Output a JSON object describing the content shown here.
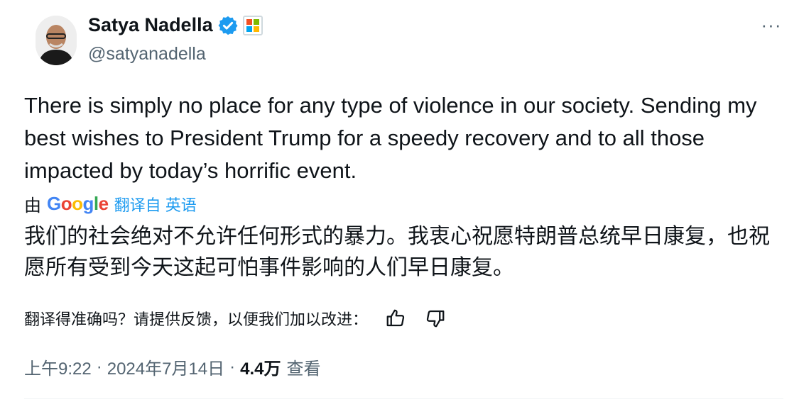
{
  "author": {
    "display_name": "Satya Nadella",
    "handle": "@satyanadella",
    "verified": true,
    "verified_color": "#1d9bf0"
  },
  "menu": {
    "more_label": "···"
  },
  "tweet": {
    "text": "There is simply no place for any type of violence in our society. Sending my best wishes to President Trump for a speedy recovery and to all those impacted by today’s horrific event."
  },
  "translation": {
    "by_label": "由",
    "provider_logo_text": "Google",
    "source_label": "翻译自 英语",
    "translated_text": "我们的社会绝对不允许任何形式的暴力。我衷心祝愿特朗普总统早日康复，也祝愿所有受到今天这起可怕事件影响的人们早日康复。",
    "feedback_prompt": "翻译得准确吗？请提供反馈，以便我们加以改进：",
    "thumbs_up_icon": "thumbs-up-icon",
    "thumbs_down_icon": "thumbs-down-icon"
  },
  "meta": {
    "time": "上午9:22",
    "date": "2024年7月14日",
    "views_count": "4.4万",
    "views_label": "查看"
  },
  "colors": {
    "link": "#1d9bf0",
    "secondary_text": "#536471",
    "primary_text": "#0f1419"
  }
}
